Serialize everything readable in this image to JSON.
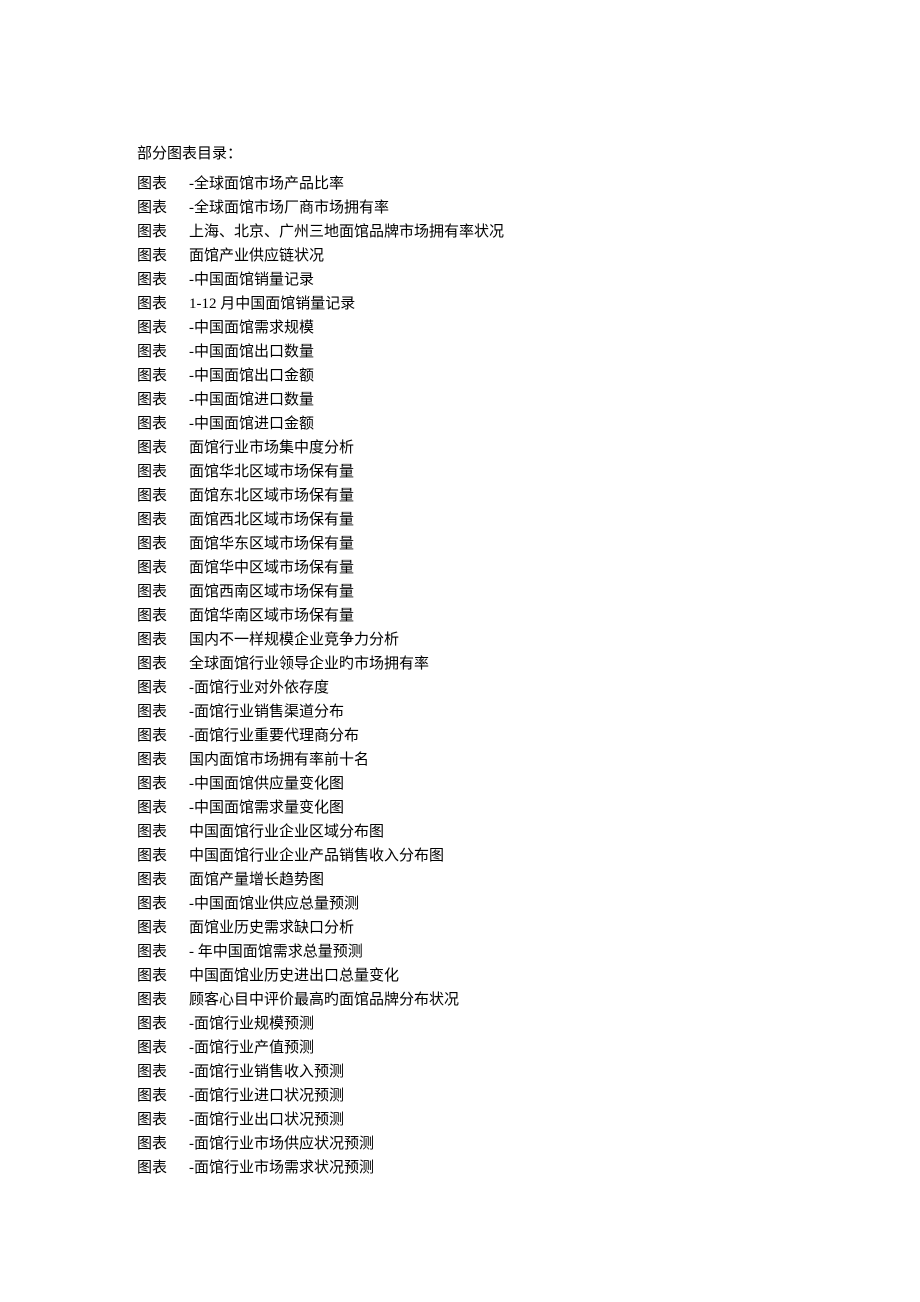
{
  "title": "部分图表目录：",
  "prefix": "图表",
  "items": [
    "-全球面馆市场产品比率",
    "-全球面馆市场厂商市场拥有率",
    "上海、北京、广州三地面馆品牌市场拥有率状况",
    "面馆产业供应链状况",
    "-中国面馆销量记录",
    "1-12 月中国面馆销量记录",
    "-中国面馆需求规模",
    "-中国面馆出口数量",
    "-中国面馆出口金额",
    "-中国面馆进口数量",
    "-中国面馆进口金额",
    "面馆行业市场集中度分析",
    "面馆华北区域市场保有量",
    "面馆东北区域市场保有量",
    "面馆西北区域市场保有量",
    "面馆华东区域市场保有量",
    "面馆华中区域市场保有量",
    "面馆西南区域市场保有量",
    "面馆华南区域市场保有量",
    "国内不一样规模企业竞争力分析",
    "全球面馆行业领导企业旳市场拥有率",
    "-面馆行业对外依存度",
    "-面馆行业销售渠道分布",
    "-面馆行业重要代理商分布",
    "国内面馆市场拥有率前十名",
    "-中国面馆供应量变化图",
    "-中国面馆需求量变化图",
    "中国面馆行业企业区域分布图",
    "中国面馆行业企业产品销售收入分布图",
    "面馆产量增长趋势图",
    "-中国面馆业供应总量预测",
    "面馆业历史需求缺口分析",
    "-  年中国面馆需求总量预测",
    "中国面馆业历史进出口总量变化",
    "顾客心目中评价最高旳面馆品牌分布状况",
    "-面馆行业规模预测",
    "-面馆行业产值预测",
    "-面馆行业销售收入预测",
    "-面馆行业进口状况预测",
    "-面馆行业出口状况预测",
    "-面馆行业市场供应状况预测",
    "-面馆行业市场需求状况预测"
  ]
}
